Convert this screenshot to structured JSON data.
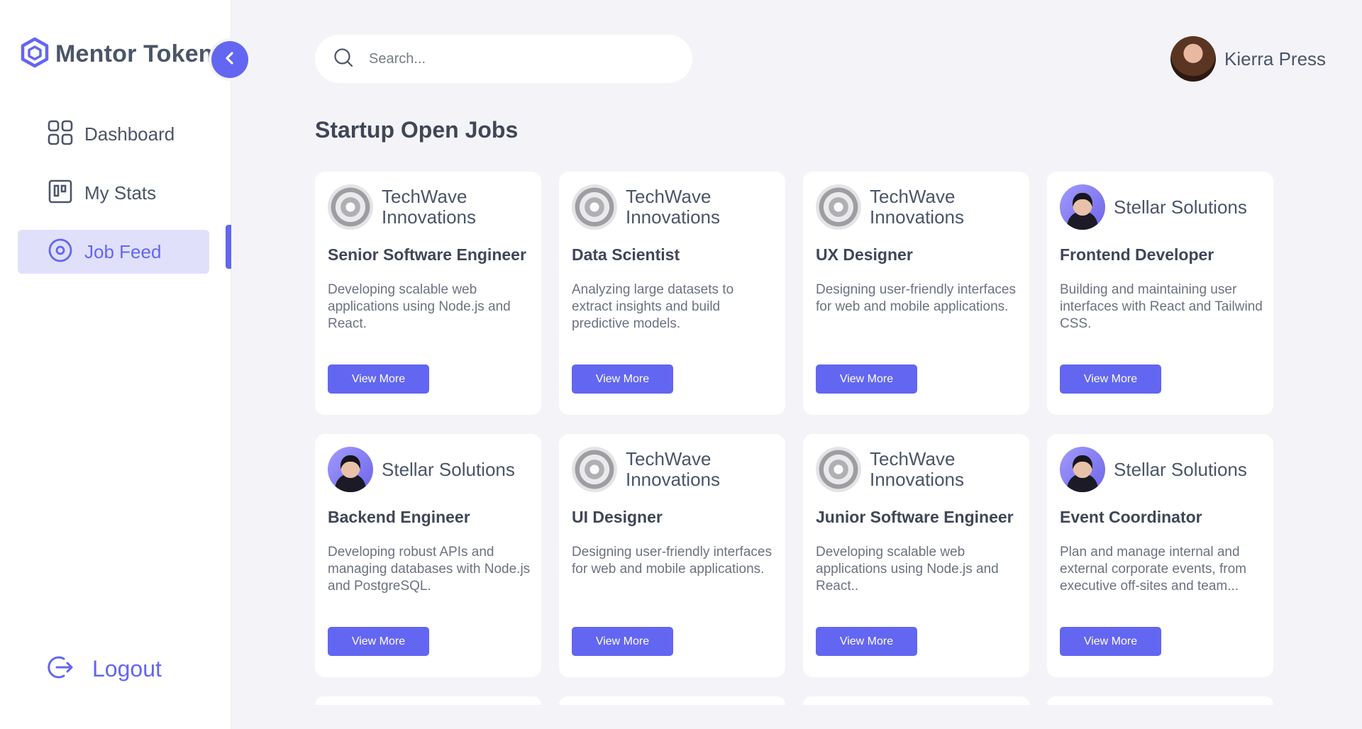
{
  "brand": {
    "name": "Mentor Token",
    "icon": "hexagon-cube-icon"
  },
  "sidebar": {
    "items": [
      {
        "label": "Dashboard",
        "icon": "grid-icon",
        "active": false
      },
      {
        "label": "My Stats",
        "icon": "board-icon",
        "active": false
      },
      {
        "label": "Job Feed",
        "icon": "target-icon",
        "active": true
      }
    ],
    "logout_label": "Logout",
    "collapse_icon": "chevron-left-icon"
  },
  "search": {
    "placeholder": "Search...",
    "icon": "search-icon"
  },
  "user": {
    "name": "Kierra Press"
  },
  "page": {
    "title": "Startup Open Jobs"
  },
  "colors": {
    "accent": "#6366f1",
    "active_bg": "#e0e0fb",
    "page_bg": "#f4f4f8"
  },
  "jobs": [
    {
      "company": "TechWave Innovations",
      "logo": "techwave-logo",
      "role": "Senior Software Engineer",
      "description": "Developing scalable web applications using Node.js and React.",
      "button": "View More"
    },
    {
      "company": "TechWave Innovations",
      "logo": "techwave-logo",
      "role": "Data Scientist",
      "description": "Analyzing large datasets to extract insights and build predictive models.",
      "button": "View More"
    },
    {
      "company": "TechWave Innovations",
      "logo": "techwave-logo",
      "role": "UX Designer",
      "description": "Designing user-friendly interfaces for web and mobile applications.",
      "button": "View More"
    },
    {
      "company": "Stellar Solutions",
      "logo": "stellar-logo",
      "role": "Frontend Developer",
      "description": "Building and maintaining user interfaces with React and Tailwind CSS.",
      "button": "View More"
    },
    {
      "company": "Stellar Solutions",
      "logo": "stellar-logo",
      "role": "Backend Engineer",
      "description": "Developing robust APIs and managing databases with Node.js and PostgreSQL.",
      "button": "View More"
    },
    {
      "company": "TechWave Innovations",
      "logo": "techwave-logo",
      "role": "UI Designer",
      "description": "Designing user-friendly interfaces for web and mobile applications.",
      "button": "View More"
    },
    {
      "company": "TechWave Innovations",
      "logo": "techwave-logo",
      "role": "Junior Software Engineer",
      "description": "Developing scalable web applications using Node.js and React..",
      "button": "View More"
    },
    {
      "company": "Stellar Solutions",
      "logo": "stellar-logo",
      "role": "Event Coordinator",
      "description": "Plan and manage internal and external corporate events, from executive off-sites and team...",
      "button": "View More"
    }
  ]
}
